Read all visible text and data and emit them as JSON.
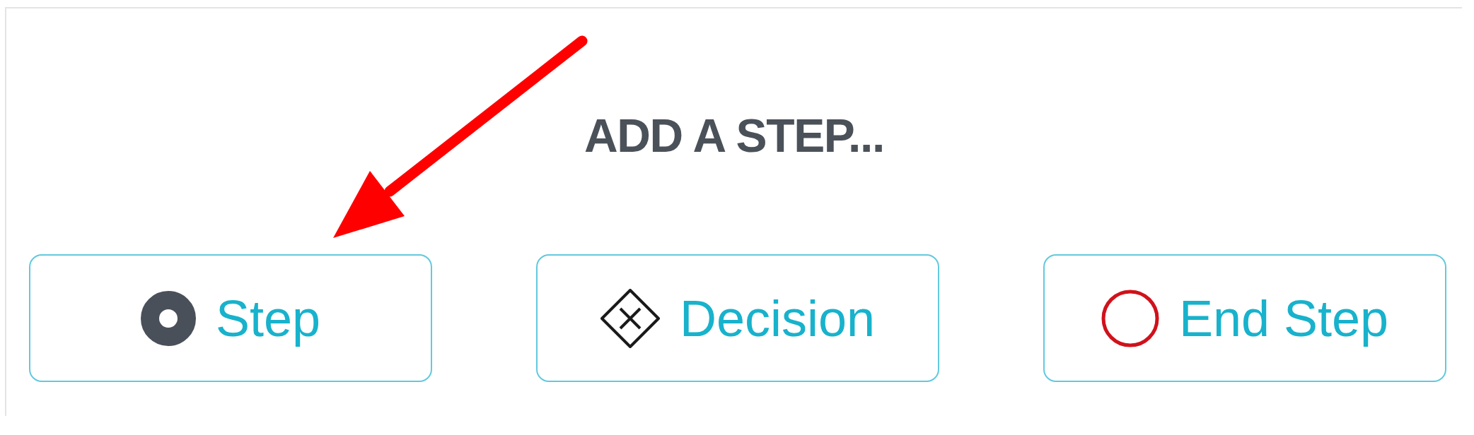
{
  "heading": "ADD A STEP...",
  "buttons": [
    {
      "kind": "step",
      "label": "Step"
    },
    {
      "kind": "decision",
      "label": "Decision"
    },
    {
      "kind": "end",
      "label": "End Step"
    }
  ]
}
